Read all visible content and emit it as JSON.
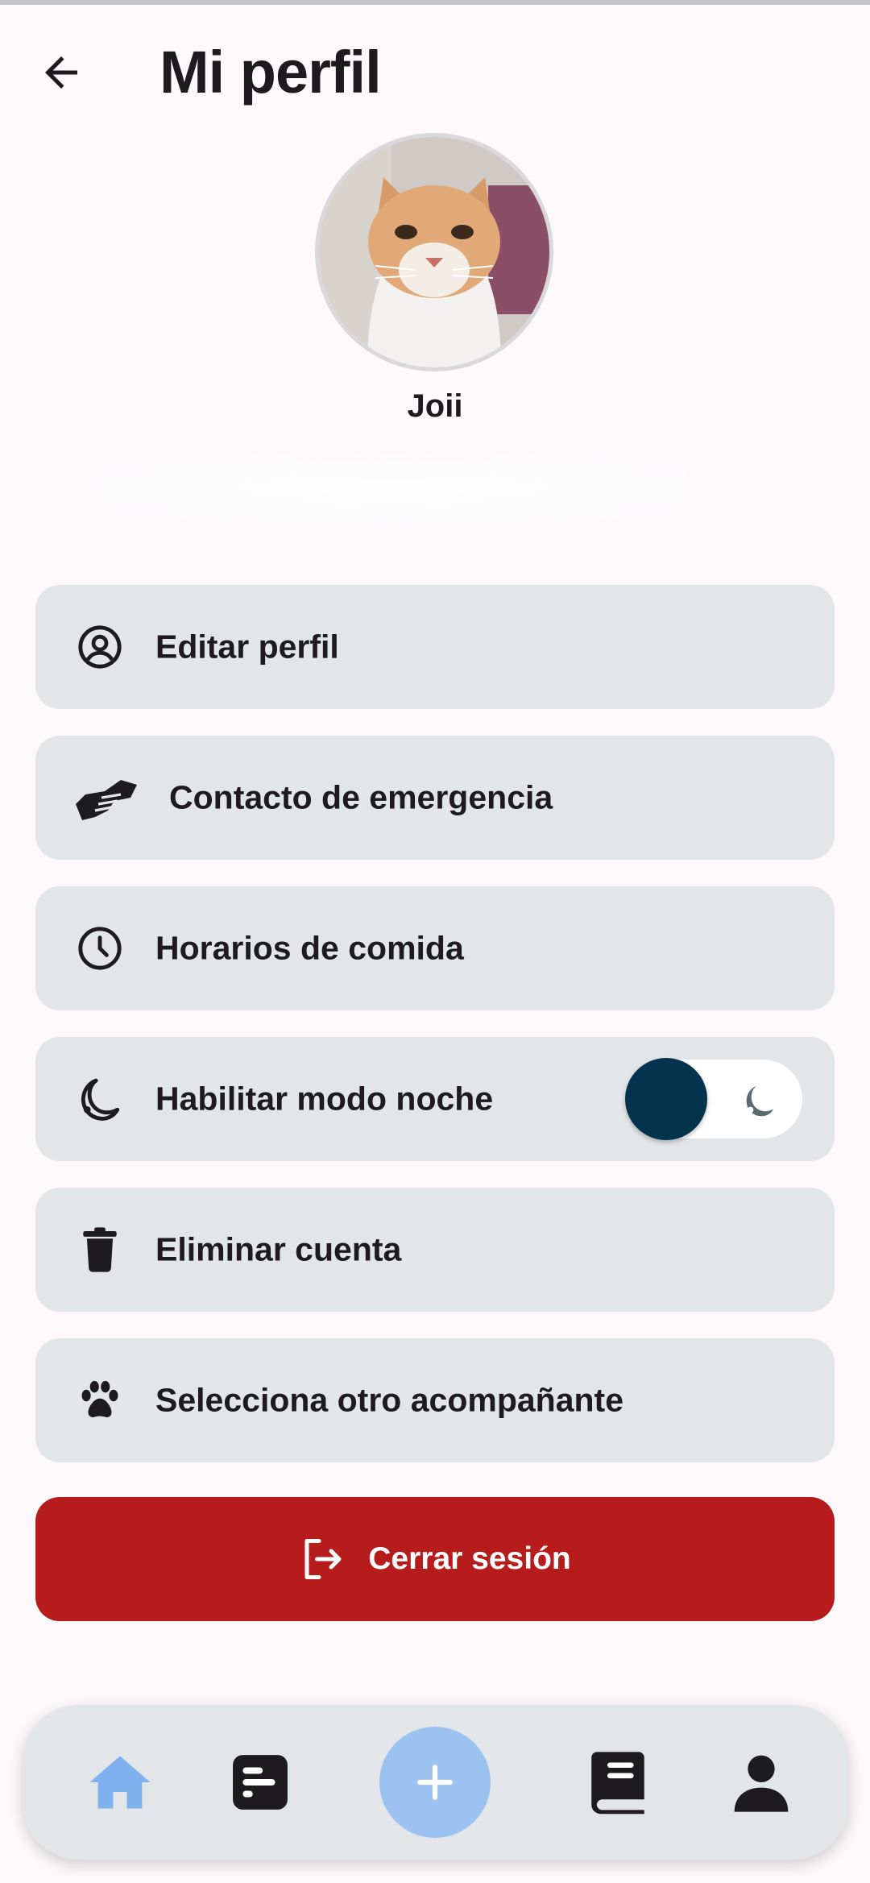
{
  "header": {
    "title": "Mi perfil",
    "back_icon": "arrow-left-icon"
  },
  "profile": {
    "name": "Joii",
    "avatar_icon": "cat-photo-avatar"
  },
  "menu": {
    "items": [
      {
        "label": "Editar perfil",
        "icon": "user-circle-icon"
      },
      {
        "label": "Contacto de emergencia",
        "icon": "handshake-icon"
      },
      {
        "label": "Horarios de comida",
        "icon": "clock-icon"
      },
      {
        "label": "Habilitar modo noche",
        "icon": "moon-icon",
        "toggle_on": false
      },
      {
        "label": "Eliminar cuenta",
        "icon": "trash-icon"
      },
      {
        "label": "Selecciona otro acompañante",
        "icon": "paw-icon"
      }
    ]
  },
  "logout": {
    "label": "Cerrar sesión",
    "icon": "logout-icon"
  },
  "bottom_nav": {
    "items": [
      "home-icon",
      "stats-icon",
      "add-icon",
      "book-icon",
      "person-icon"
    ],
    "active": "home-icon"
  },
  "colors": {
    "background": "#fdf9fb",
    "card": "#e2e6e9",
    "danger": "#b71c1c",
    "toggle_knob": "#04334e",
    "accent": "#9cc2f2"
  }
}
